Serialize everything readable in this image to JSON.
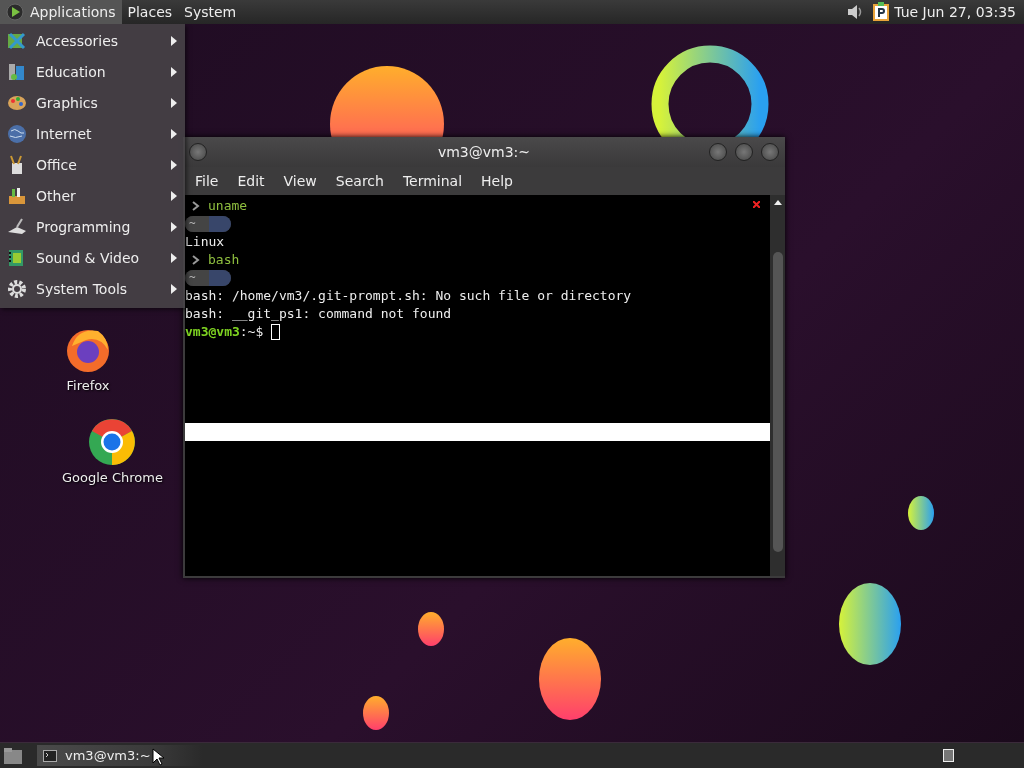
{
  "top_panel": {
    "menus": [
      {
        "label": "Applications",
        "selected": true
      },
      {
        "label": "Places",
        "selected": false
      },
      {
        "label": "System",
        "selected": false
      }
    ],
    "clock": "Tue Jun 27, 03:35"
  },
  "applications_menu": {
    "items": [
      {
        "label": "Accessories"
      },
      {
        "label": "Education"
      },
      {
        "label": "Graphics"
      },
      {
        "label": "Internet"
      },
      {
        "label": "Office"
      },
      {
        "label": "Other"
      },
      {
        "label": "Programming"
      },
      {
        "label": "Sound & Video"
      },
      {
        "label": "System Tools"
      }
    ]
  },
  "desktop_icons": [
    {
      "label": "Firefox"
    },
    {
      "label": "Google Chrome"
    }
  ],
  "terminal": {
    "title": "vm3@vm3:~",
    "menu": [
      "File",
      "Edit",
      "View",
      "Search",
      "Terminal",
      "Help"
    ],
    "lines": [
      {
        "kind": "command",
        "text": "uname"
      },
      {
        "kind": "pill",
        "text": "~"
      },
      {
        "kind": "output",
        "text": "Linux"
      },
      {
        "kind": "command",
        "text": "bash"
      },
      {
        "kind": "pill",
        "text": "~"
      },
      {
        "kind": "output",
        "text": "bash: /home/vm3/.git-prompt.sh: No such file or directory"
      },
      {
        "kind": "output",
        "text": "bash: __git_ps1: command not found"
      },
      {
        "kind": "prompt",
        "user": "vm3@vm3",
        "path": ":~$"
      }
    ]
  },
  "taskbar": {
    "tasks": [
      {
        "label": "vm3@vm3:~",
        "selected": true
      }
    ]
  }
}
